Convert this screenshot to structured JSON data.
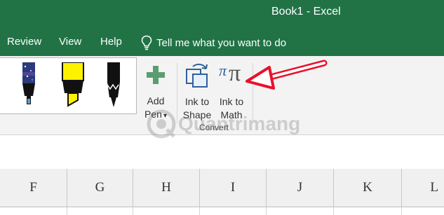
{
  "window": {
    "title": "Book1  -  Excel"
  },
  "menu": {
    "items": [
      {
        "label": "Review"
      },
      {
        "label": "View"
      },
      {
        "label": "Help"
      }
    ],
    "tell_me": "Tell me what you want to do"
  },
  "ribbon": {
    "add_pen": {
      "line1": "Add",
      "line2": "Pen",
      "caret": "▾"
    },
    "ink_to_shape": {
      "line1": "Ink to",
      "line2": "Shape"
    },
    "ink_to_math": {
      "line1": "Ink to",
      "line2": "Math",
      "glyph_small": "π",
      "glyph_large": "π"
    },
    "group_label": "Convert"
  },
  "watermark": {
    "text": "Quantrimang"
  },
  "sheet": {
    "columns": [
      "F",
      "G",
      "H",
      "I",
      "J",
      "K",
      "L"
    ]
  },
  "colors": {
    "accent": "#217346",
    "annotation_arrow": "#e8122a"
  }
}
